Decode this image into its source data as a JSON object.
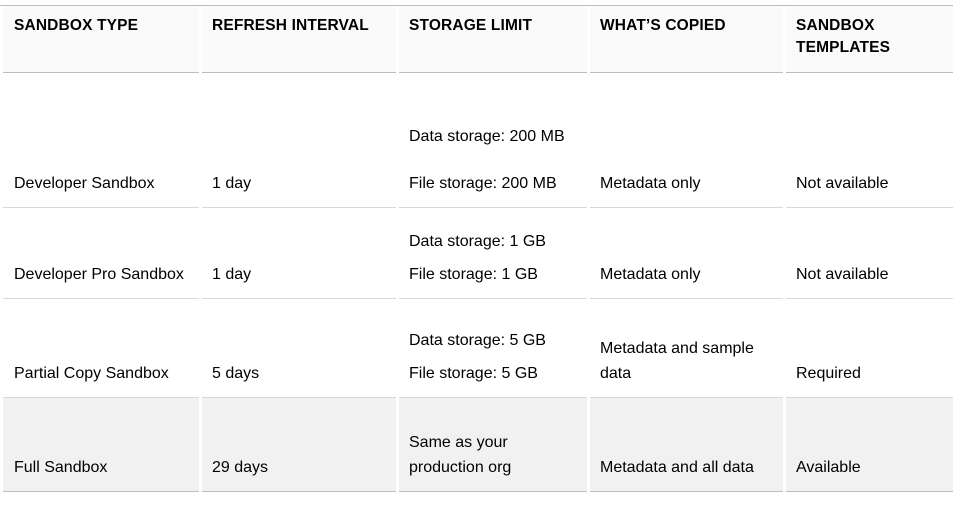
{
  "table": {
    "name": "salesforce-sandbox-types-comparison",
    "columns": [
      {
        "key": "sandbox_type",
        "label": "SANDBOX TYPE"
      },
      {
        "key": "refresh_interval",
        "label": "REFRESH INTERVAL"
      },
      {
        "key": "storage_limit",
        "label": "STORAGE LIMIT"
      },
      {
        "key": "whats_copied",
        "label": "WHAT’S COPIED"
      },
      {
        "key": "sandbox_templates",
        "label": "SANDBOX TEMPLATES"
      }
    ],
    "rows": [
      {
        "sandbox_type": "Developer Sandbox",
        "refresh_interval": "1 day",
        "storage_data": "Data storage: 200 MB",
        "storage_file": "File storage: 200 MB",
        "whats_copied": "Metadata only",
        "sandbox_templates": "Not available",
        "shaded": false
      },
      {
        "sandbox_type": "Developer Pro Sandbox",
        "refresh_interval": "1 day",
        "storage_data": "Data storage: 1 GB",
        "storage_file": "File storage: 1 GB",
        "whats_copied": "Metadata only",
        "sandbox_templates": "Not available",
        "shaded": false
      },
      {
        "sandbox_type": "Partial Copy Sandbox",
        "refresh_interval": "5 days",
        "storage_data": "Data storage: 5 GB",
        "storage_file": "File storage: 5 GB",
        "whats_copied": "Metadata and sample data",
        "sandbox_templates": "Required",
        "shaded": false
      },
      {
        "sandbox_type": "Full Sandbox",
        "refresh_interval": "29 days",
        "storage_data": "Same as your production org",
        "storage_file": "",
        "whats_copied": "Metadata and all data",
        "sandbox_templates": "Available",
        "shaded": true
      }
    ]
  },
  "colors": {
    "header_background": "#fafafa",
    "shaded_row_background": "#f1f1f1",
    "row_background": "#ffffff",
    "border_strong": "#bdbdbd",
    "border_light": "#d9d9d9",
    "text": "#000000"
  }
}
